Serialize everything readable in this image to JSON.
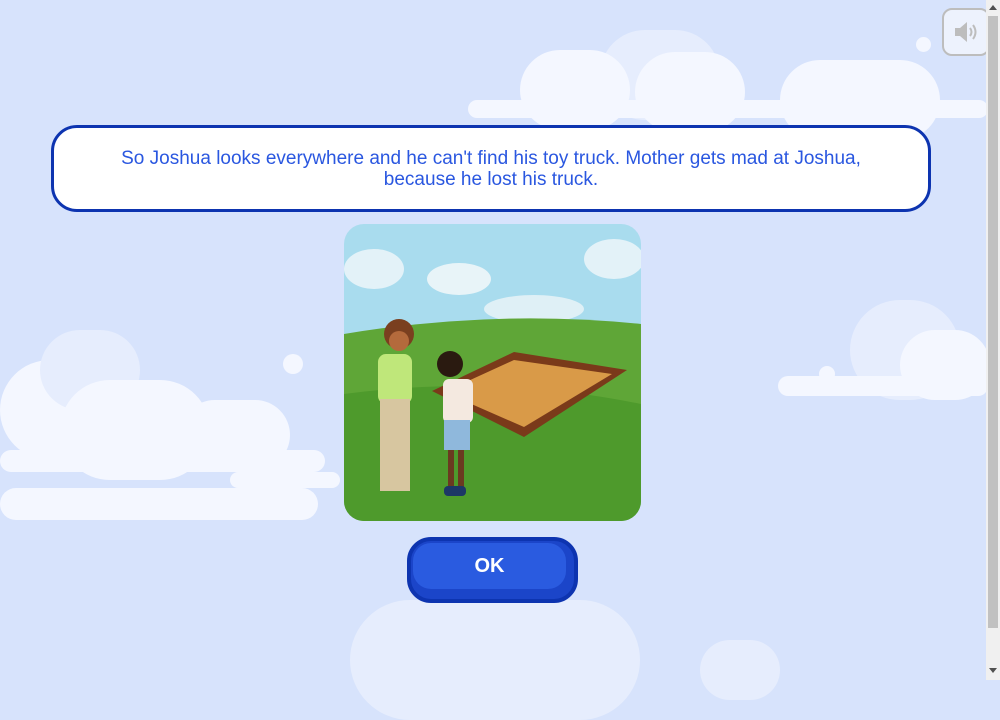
{
  "story": {
    "text": "So Joshua looks everywhere and he can't find his toy truck. Mother gets mad at Joshua, because he lost his truck."
  },
  "buttons": {
    "ok_label": "OK",
    "sound_icon": "speaker-icon"
  },
  "colors": {
    "accent": "#2a5be0",
    "border": "#0d34b0",
    "background": "#d7e3fc",
    "text": "#2a57e0"
  }
}
